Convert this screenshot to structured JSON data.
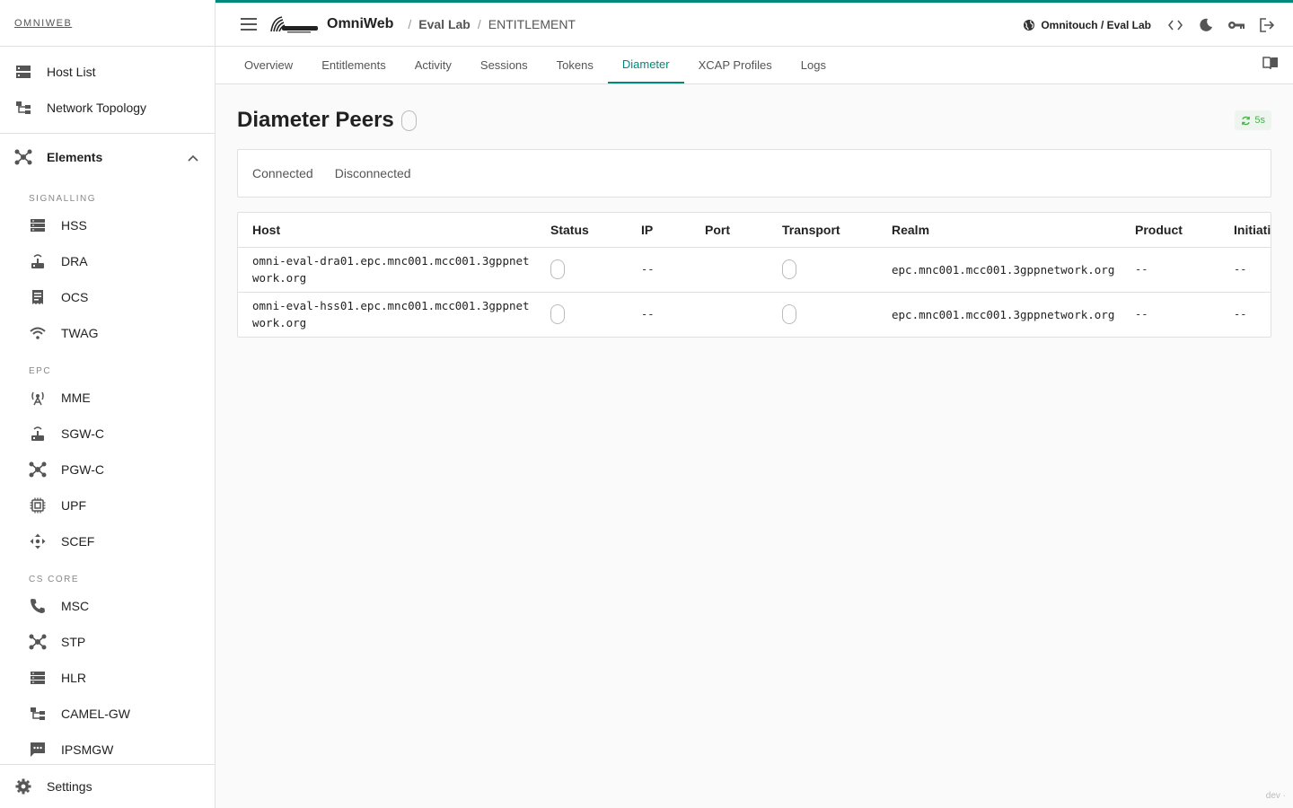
{
  "brand": "OMNIWEB",
  "nav_top": [
    {
      "label": "Host List",
      "icon": "host-list-icon"
    },
    {
      "label": "Network Topology",
      "icon": "topology-icon"
    }
  ],
  "elements": {
    "label": "Elements"
  },
  "sections": [
    {
      "label": "SIGNALLING",
      "items": [
        {
          "label": "HSS",
          "icon": "storage-icon"
        },
        {
          "label": "DRA",
          "icon": "router-icon"
        },
        {
          "label": "OCS",
          "icon": "receipt-icon"
        },
        {
          "label": "TWAG",
          "icon": "wifi-icon"
        }
      ]
    },
    {
      "label": "EPC",
      "items": [
        {
          "label": "MME",
          "icon": "antenna-icon"
        },
        {
          "label": "SGW-C",
          "icon": "router-icon"
        },
        {
          "label": "PGW-C",
          "icon": "hub-icon"
        },
        {
          "label": "UPF",
          "icon": "chip-icon"
        },
        {
          "label": "SCEF",
          "icon": "move-icon"
        }
      ]
    },
    {
      "label": "CS CORE",
      "items": [
        {
          "label": "MSC",
          "icon": "phone-icon"
        },
        {
          "label": "STP",
          "icon": "hub-icon"
        },
        {
          "label": "HLR",
          "icon": "storage-icon"
        },
        {
          "label": "CAMEL-GW",
          "icon": "topology-icon"
        },
        {
          "label": "IPSMGW",
          "icon": "sms-icon"
        }
      ]
    }
  ],
  "settings": "Settings",
  "topbar": {
    "app_name": "OmniWeb",
    "breadcrumb": [
      "Eval Lab",
      "ENTITLEMENT"
    ],
    "tenant": "Omnitouch / Eval Lab"
  },
  "tabs": [
    "Overview",
    "Entitlements",
    "Activity",
    "Sessions",
    "Tokens",
    "Diameter",
    "XCAP Profiles",
    "Logs"
  ],
  "active_tab": "Diameter",
  "page": {
    "title": "Diameter Peers",
    "refresh": "5s",
    "filters": [
      "Connected",
      "Disconnected"
    ]
  },
  "table": {
    "columns": [
      "Host",
      "Status",
      "IP",
      "Port",
      "Transport",
      "Realm",
      "Product",
      "Initiati"
    ],
    "rows": [
      {
        "host": "omni-eval-dra01.epc.mnc001.mcc001.3gppnetwork.org",
        "ip": "--",
        "port": "",
        "realm": "epc.mnc001.mcc001.3gppnetwork.org",
        "product": "--",
        "initiated": "--"
      },
      {
        "host": "omni-eval-hss01.epc.mnc001.mcc001.3gppnetwork.org",
        "ip": "--",
        "port": "",
        "realm": "epc.mnc001.mcc001.3gppnetwork.org",
        "product": "--",
        "initiated": "--"
      }
    ]
  },
  "footer": "dev ·",
  "colors": {
    "accent": "#00897b",
    "refresh_green": "#4caf50"
  }
}
